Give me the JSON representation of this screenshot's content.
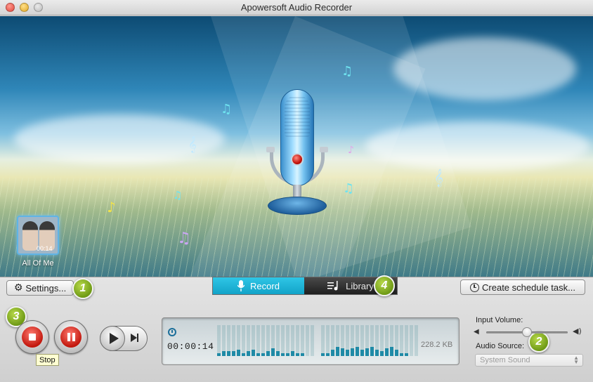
{
  "window": {
    "title": "Apowersoft Audio Recorder"
  },
  "now_playing": {
    "track_label": "All Of Me",
    "thumb_time": "00:14"
  },
  "toolbar": {
    "settings_label": "Settings...",
    "schedule_label": "Create schedule task..."
  },
  "tabs": [
    {
      "label": "Record",
      "icon": "microphone-icon",
      "active": true
    },
    {
      "label": "Library",
      "icon": "playlist-icon",
      "active": false
    }
  ],
  "badges": [
    "1",
    "2",
    "3",
    "4"
  ],
  "transport": {
    "tooltip": "Stop"
  },
  "display": {
    "elapsed": "00:00:14",
    "file_size": "228.2 KB",
    "meter_left": [
      0.1,
      0.15,
      0.15,
      0.15,
      0.2,
      0.1,
      0.15,
      0.2,
      0.1,
      0.1,
      0.15,
      0.25,
      0.15,
      0.1,
      0.1,
      0.15,
      0.1,
      0.1
    ],
    "meter_right": [
      0.1,
      0.1,
      0.2,
      0.3,
      0.25,
      0.2,
      0.25,
      0.3,
      0.2,
      0.25,
      0.3,
      0.2,
      0.15,
      0.25,
      0.3,
      0.2,
      0.1,
      0.1
    ]
  },
  "audio": {
    "input_volume_label": "Input Volume:",
    "input_volume_level": 0.5,
    "source_label": "Audio Source:",
    "source_value": "System Sound"
  },
  "colors": {
    "accent": "#16a9cd",
    "badge": "#7ea71d",
    "record_red": "#d1231a"
  }
}
